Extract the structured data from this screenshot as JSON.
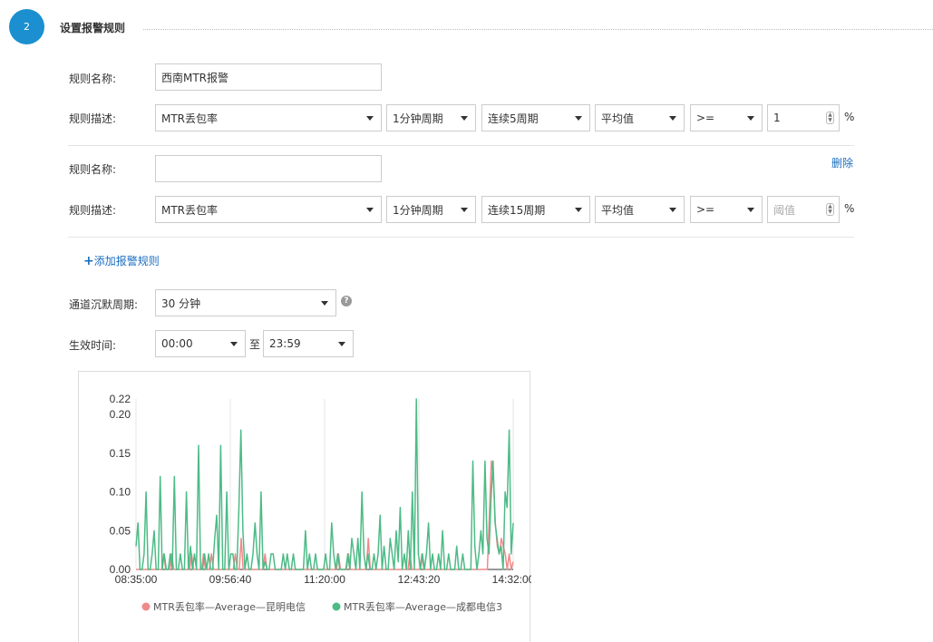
{
  "step": {
    "number": "2",
    "title": "设置报警规则"
  },
  "rules": [
    {
      "name_label": "规则名称:",
      "name_value": "西南MTR报警",
      "desc_label": "规则描述:",
      "metric": "MTR丢包率",
      "period": "1分钟周期",
      "consecutive": "连续5周期",
      "statistic": "平均值",
      "operator": ">=",
      "threshold": "1",
      "threshold_placeholder": "",
      "unit": "%"
    },
    {
      "name_label": "规则名称:",
      "name_value": "",
      "delete_label": "删除",
      "desc_label": "规则描述:",
      "metric": "MTR丢包率",
      "period": "1分钟周期",
      "consecutive": "连续15周期",
      "statistic": "平均值",
      "operator": ">=",
      "threshold": "",
      "threshold_placeholder": "阈值",
      "unit": "%"
    }
  ],
  "add_rule_label": "添加报警规则",
  "silence": {
    "label": "通道沉默周期:",
    "value": "30 分钟"
  },
  "effective": {
    "label": "生效时间:",
    "start": "00:00",
    "separator": "至",
    "end": "23:59"
  },
  "colors": {
    "accent": "#1b8fcf",
    "series_kunming": "#f08a8a",
    "series_chengdu": "#4dbb86"
  },
  "chart_data": {
    "type": "line",
    "title": "",
    "xlabel": "",
    "ylabel": "",
    "ylim": [
      0,
      0.22
    ],
    "yticks": [
      "0.22",
      "0.20",
      "0.15",
      "0.10",
      "0.05",
      "0.00"
    ],
    "xticks": [
      "08:35:00",
      "09:56:40",
      "11:20:00",
      "12:43:20",
      "14:32:00"
    ],
    "grid": true,
    "legend_position": "bottom",
    "series": [
      {
        "name": "MTR丢包率—Average—昆明电信",
        "values": [
          0,
          0,
          0,
          0,
          0,
          0,
          0,
          0,
          0,
          0,
          0,
          0,
          0,
          0,
          0.02,
          0,
          0,
          0,
          0.02,
          0,
          0,
          0,
          0,
          0,
          0,
          0,
          0,
          0,
          0.02,
          0,
          0,
          0,
          0,
          0,
          0.02,
          0,
          0,
          0,
          0.02,
          0,
          0,
          0,
          0,
          0,
          0,
          0,
          0,
          0,
          0,
          0,
          0.02,
          0,
          0,
          0.04,
          0,
          0,
          0,
          0,
          0,
          0,
          0,
          0,
          0,
          0,
          0,
          0.02,
          0,
          0,
          0,
          0,
          0,
          0,
          0,
          0,
          0,
          0,
          0,
          0,
          0,
          0,
          0,
          0,
          0,
          0,
          0,
          0,
          0,
          0,
          0,
          0,
          0,
          0,
          0,
          0,
          0,
          0,
          0,
          0,
          0,
          0,
          0,
          0,
          0.02,
          0,
          0,
          0,
          0,
          0.02,
          0,
          0,
          0,
          0,
          0,
          0,
          0,
          0,
          0,
          0.04,
          0,
          0,
          0,
          0,
          0,
          0,
          0,
          0,
          0,
          0,
          0,
          0,
          0,
          0,
          0,
          0,
          0,
          0,
          0,
          0,
          0.02,
          0,
          0,
          0,
          0,
          0,
          0.02,
          0,
          0,
          0,
          0,
          0,
          0,
          0,
          0,
          0,
          0,
          0,
          0,
          0,
          0,
          0,
          0,
          0,
          0,
          0,
          0,
          0,
          0,
          0,
          0,
          0,
          0,
          0,
          0,
          0,
          0,
          0,
          0,
          0,
          0.07,
          0.14,
          0.12,
          0.06,
          0.03,
          0.02,
          0.04,
          0.03,
          0.02,
          0,
          0.02,
          0,
          0.01
        ]
      },
      {
        "name": "MTR丢包率—Average—成都电信3",
        "values": [
          0.03,
          0.06,
          0,
          0,
          0.02,
          0.1,
          0,
          0,
          0.02,
          0.05,
          0,
          0,
          0.12,
          0,
          0.02,
          0,
          0,
          0.02,
          0,
          0.12,
          0,
          0,
          0.02,
          0,
          0,
          0.1,
          0,
          0.03,
          0,
          0.02,
          0,
          0.16,
          0,
          0,
          0.02,
          0,
          0.02,
          0,
          0,
          0.04,
          0.07,
          0,
          0.16,
          0,
          0,
          0.1,
          0,
          0.02,
          0.02,
          0,
          0,
          0.08,
          0.18,
          0.05,
          0,
          0.02,
          0,
          0,
          0.02,
          0.06,
          0.02,
          0,
          0.1,
          0,
          0.01,
          0,
          0,
          0.02,
          0.02,
          0,
          0,
          0,
          0,
          0.02,
          0,
          0.02,
          0,
          0,
          0.02,
          0,
          0,
          0,
          0,
          0,
          0.05,
          0,
          0.02,
          0,
          0,
          0.02,
          0,
          0,
          0,
          0,
          0.02,
          0,
          0,
          0.06,
          0.02,
          0,
          0.02,
          0,
          0,
          0,
          0,
          0.02,
          0,
          0.04,
          0.02,
          0,
          0.04,
          0,
          0.1,
          0.02,
          0,
          0.02,
          0,
          0,
          0.02,
          0,
          0.02,
          0.07,
          0,
          0.03,
          0,
          0,
          0.04,
          0.02,
          0,
          0.05,
          0.01,
          0.08,
          0,
          0.02,
          0,
          0.05,
          0,
          0.1,
          0,
          0.22,
          0.02,
          0,
          0.02,
          0,
          0.02,
          0.06,
          0,
          0.02,
          0,
          0,
          0.02,
          0,
          0.05,
          0,
          0,
          0.02,
          0,
          0,
          0,
          0.03,
          0,
          0,
          0.02,
          0,
          0,
          0,
          0,
          0.14,
          0.03,
          0,
          0.02,
          0.05,
          0.02,
          0.14,
          0.04,
          0.02,
          0.09,
          0.14,
          0.06,
          0.04,
          0.02,
          0.03,
          0,
          0.1,
          0.08,
          0.18,
          0.02,
          0.06
        ]
      }
    ]
  }
}
